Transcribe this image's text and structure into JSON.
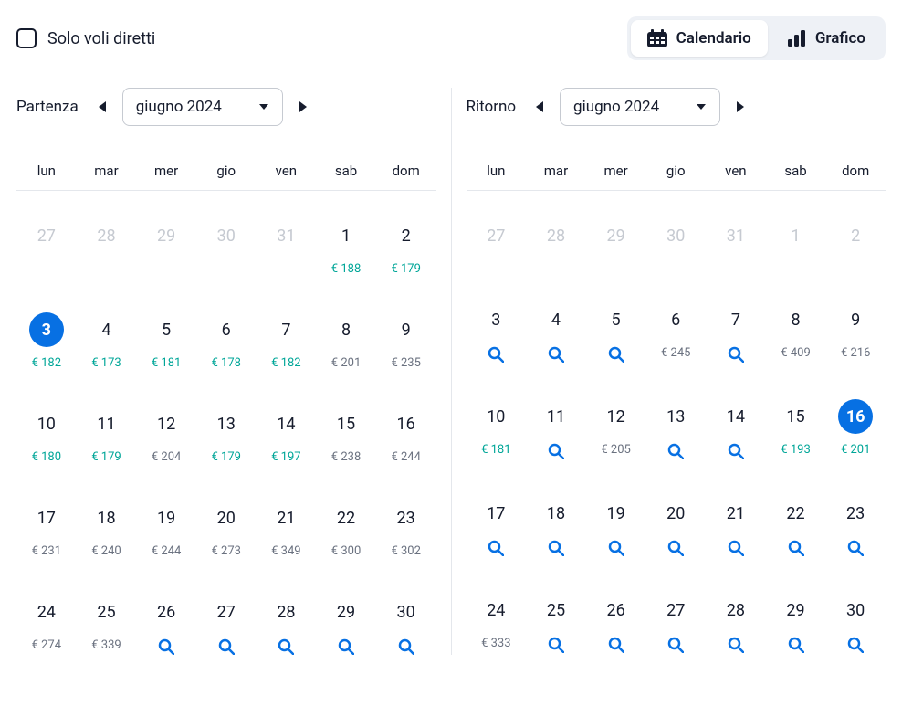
{
  "direct_only_label": "Solo voli diretti",
  "view_toggle": {
    "calendar": "Calendario",
    "chart": "Grafico"
  },
  "departure": {
    "title": "Partenza",
    "month": "giugno 2024",
    "weekdays": [
      "lun",
      "mar",
      "mer",
      "gio",
      "ven",
      "sab",
      "dom"
    ],
    "days": [
      {
        "n": "27",
        "disabled": true
      },
      {
        "n": "28",
        "disabled": true
      },
      {
        "n": "29",
        "disabled": true
      },
      {
        "n": "30",
        "disabled": true
      },
      {
        "n": "31",
        "disabled": true
      },
      {
        "n": "1",
        "price": "€ 188",
        "tier": "low"
      },
      {
        "n": "2",
        "price": "€ 179",
        "tier": "low"
      },
      {
        "n": "3",
        "price": "€ 182",
        "tier": "low",
        "selected": true
      },
      {
        "n": "4",
        "price": "€ 173",
        "tier": "low"
      },
      {
        "n": "5",
        "price": "€ 181",
        "tier": "low"
      },
      {
        "n": "6",
        "price": "€ 178",
        "tier": "low"
      },
      {
        "n": "7",
        "price": "€ 182",
        "tier": "low"
      },
      {
        "n": "8",
        "price": "€ 201",
        "tier": "mid"
      },
      {
        "n": "9",
        "price": "€ 235",
        "tier": "mid"
      },
      {
        "n": "10",
        "price": "€ 180",
        "tier": "low"
      },
      {
        "n": "11",
        "price": "€ 179",
        "tier": "low"
      },
      {
        "n": "12",
        "price": "€ 204",
        "tier": "mid"
      },
      {
        "n": "13",
        "price": "€ 179",
        "tier": "low"
      },
      {
        "n": "14",
        "price": "€ 197",
        "tier": "low"
      },
      {
        "n": "15",
        "price": "€ 238",
        "tier": "mid"
      },
      {
        "n": "16",
        "price": "€ 244",
        "tier": "mid"
      },
      {
        "n": "17",
        "price": "€ 231",
        "tier": "mid"
      },
      {
        "n": "18",
        "price": "€ 240",
        "tier": "mid"
      },
      {
        "n": "19",
        "price": "€ 244",
        "tier": "mid"
      },
      {
        "n": "20",
        "price": "€ 273",
        "tier": "mid"
      },
      {
        "n": "21",
        "price": "€ 349",
        "tier": "mid"
      },
      {
        "n": "22",
        "price": "€ 300",
        "tier": "mid"
      },
      {
        "n": "23",
        "price": "€ 302",
        "tier": "mid"
      },
      {
        "n": "24",
        "price": "€ 274",
        "tier": "mid"
      },
      {
        "n": "25",
        "price": "€ 339",
        "tier": "mid"
      },
      {
        "n": "26",
        "search": true
      },
      {
        "n": "27",
        "search": true
      },
      {
        "n": "28",
        "search": true
      },
      {
        "n": "29",
        "search": true
      },
      {
        "n": "30",
        "search": true
      }
    ]
  },
  "return": {
    "title": "Ritorno",
    "month": "giugno 2024",
    "weekdays": [
      "lun",
      "mar",
      "mer",
      "gio",
      "ven",
      "sab",
      "dom"
    ],
    "days": [
      {
        "n": "27",
        "disabled": true
      },
      {
        "n": "28",
        "disabled": true
      },
      {
        "n": "29",
        "disabled": true
      },
      {
        "n": "30",
        "disabled": true
      },
      {
        "n": "31",
        "disabled": true
      },
      {
        "n": "1",
        "disabled": true
      },
      {
        "n": "2",
        "disabled": true
      },
      {
        "n": "3",
        "search": true
      },
      {
        "n": "4",
        "search": true
      },
      {
        "n": "5",
        "search": true
      },
      {
        "n": "6",
        "price": "€ 245",
        "tier": "mid"
      },
      {
        "n": "7",
        "search": true
      },
      {
        "n": "8",
        "price": "€ 409",
        "tier": "mid"
      },
      {
        "n": "9",
        "price": "€ 216",
        "tier": "mid"
      },
      {
        "n": "10",
        "price": "€ 181",
        "tier": "low"
      },
      {
        "n": "11",
        "search": true
      },
      {
        "n": "12",
        "price": "€ 205",
        "tier": "mid"
      },
      {
        "n": "13",
        "search": true
      },
      {
        "n": "14",
        "search": true
      },
      {
        "n": "15",
        "price": "€ 193",
        "tier": "low"
      },
      {
        "n": "16",
        "price": "€ 201",
        "tier": "low",
        "selected": true
      },
      {
        "n": "17",
        "search": true
      },
      {
        "n": "18",
        "search": true
      },
      {
        "n": "19",
        "search": true
      },
      {
        "n": "20",
        "search": true
      },
      {
        "n": "21",
        "search": true
      },
      {
        "n": "22",
        "search": true
      },
      {
        "n": "23",
        "search": true
      },
      {
        "n": "24",
        "price": "€ 333",
        "tier": "mid"
      },
      {
        "n": "25",
        "search": true
      },
      {
        "n": "26",
        "search": true
      },
      {
        "n": "27",
        "search": true
      },
      {
        "n": "28",
        "search": true
      },
      {
        "n": "29",
        "search": true
      },
      {
        "n": "30",
        "search": true
      }
    ]
  }
}
